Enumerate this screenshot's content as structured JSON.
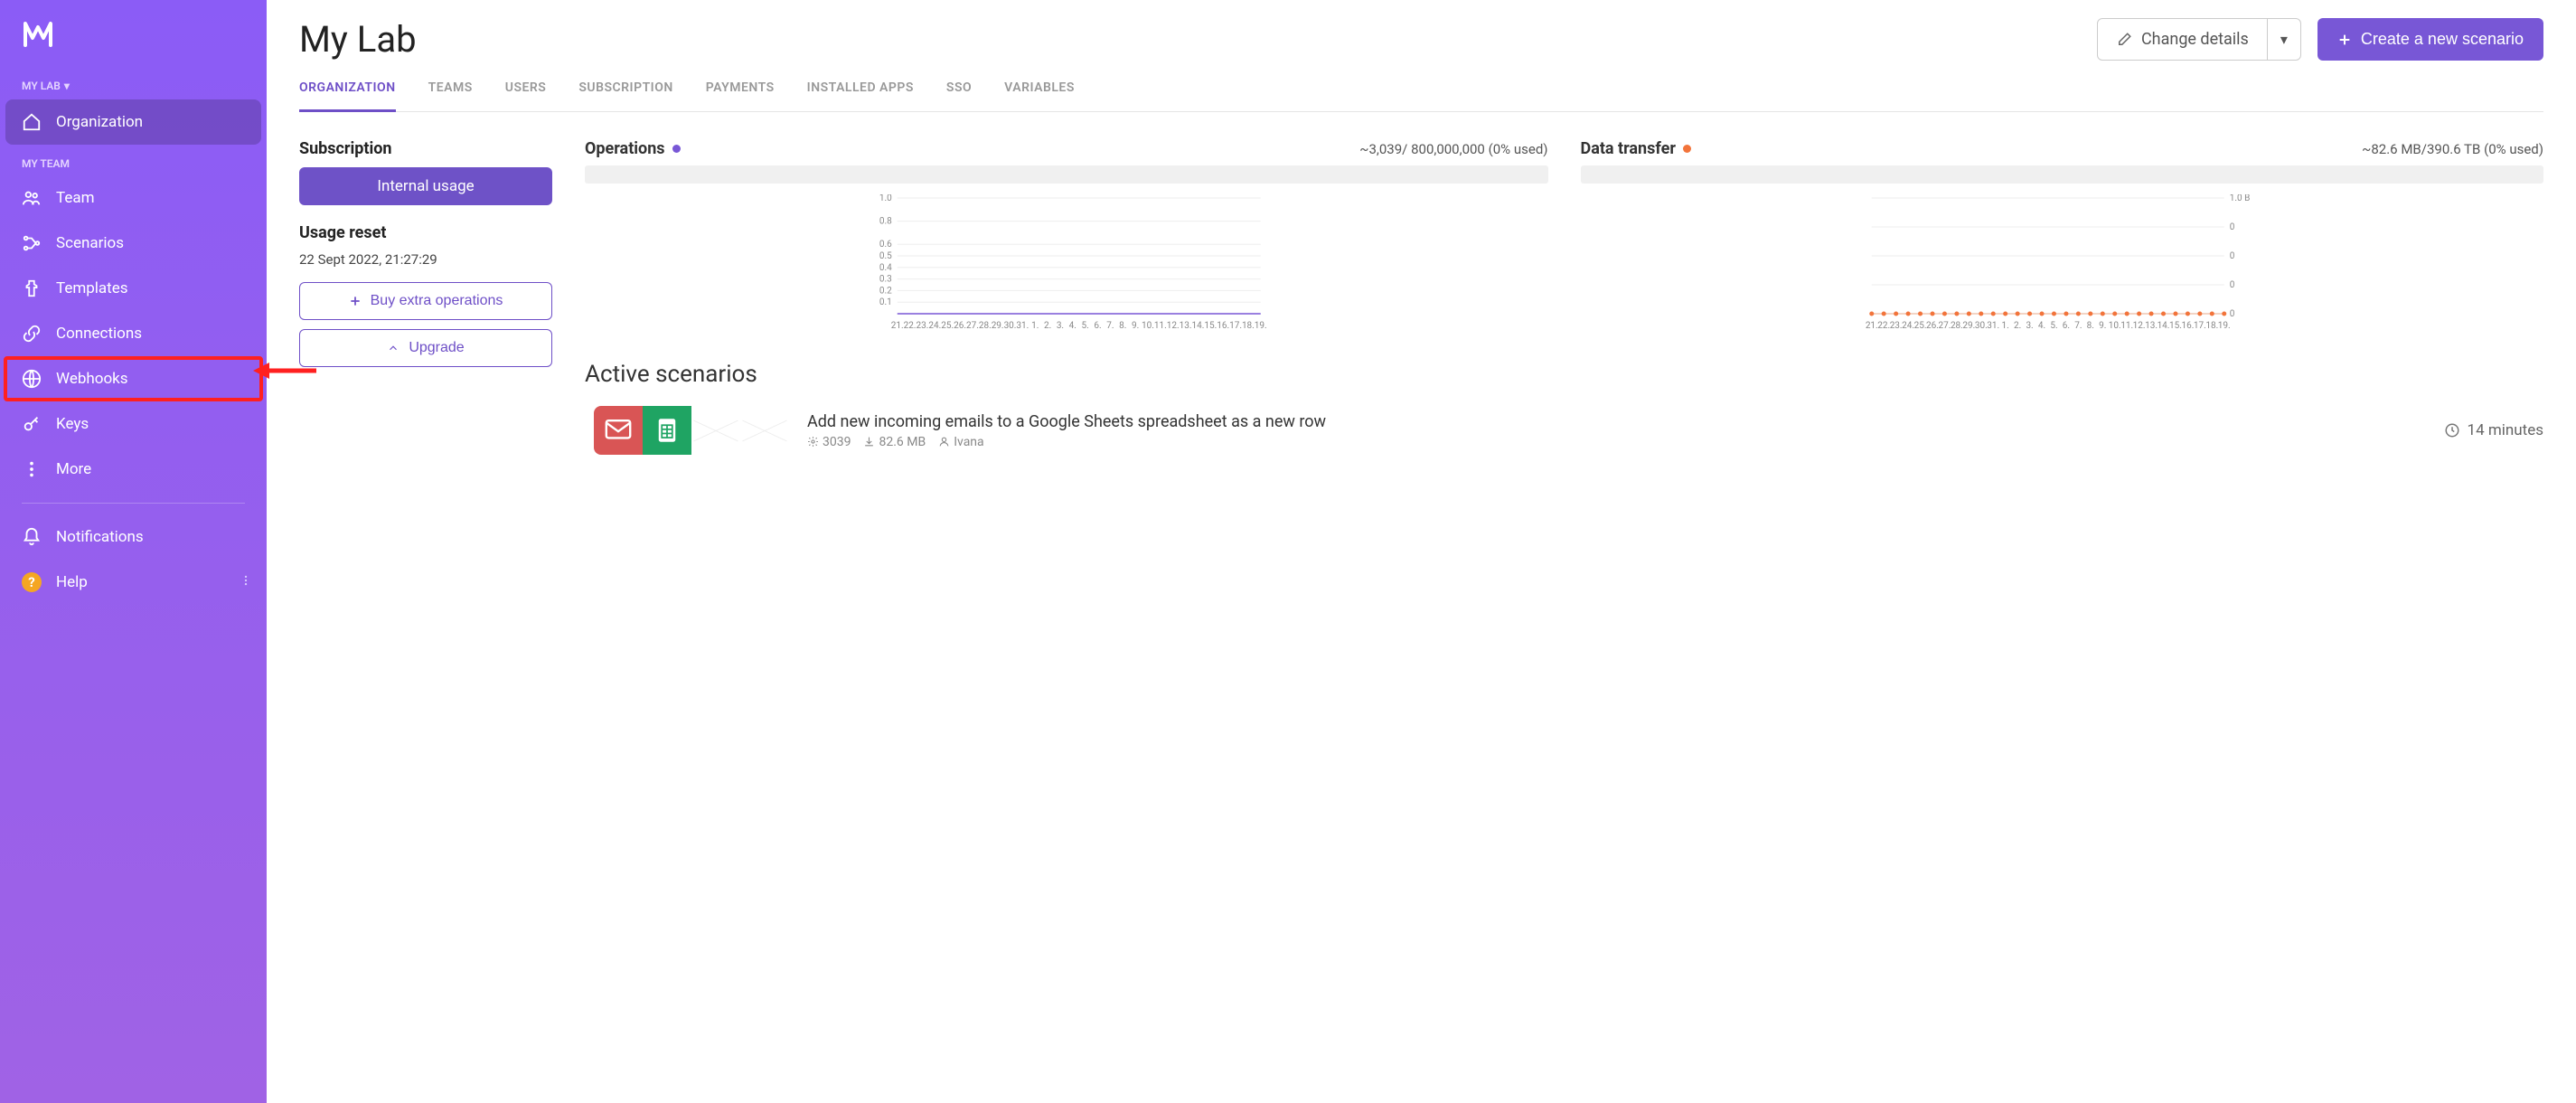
{
  "sidebar": {
    "org_selector": "MY LAB",
    "section_my_team": "MY TEAM",
    "items": {
      "organization": "Organization",
      "team": "Team",
      "scenarios": "Scenarios",
      "templates": "Templates",
      "connections": "Connections",
      "webhooks": "Webhooks",
      "keys": "Keys",
      "more": "More",
      "notifications": "Notifications",
      "help": "Help"
    }
  },
  "header": {
    "title": "My Lab",
    "change_details": "Change details",
    "create_scenario": "Create a new scenario"
  },
  "tabs": {
    "organization": "ORGANIZATION",
    "teams": "TEAMS",
    "users": "USERS",
    "subscription": "SUBSCRIPTION",
    "payments": "PAYMENTS",
    "installed_apps": "INSTALLED APPS",
    "sso": "SSO",
    "variables": "VARIABLES"
  },
  "subscription": {
    "heading": "Subscription",
    "badge": "Internal usage",
    "usage_reset": "Usage reset",
    "usage_reset_date": "22 Sept 2022, 21:27:29",
    "buy_extra": "Buy extra operations",
    "upgrade": "Upgrade"
  },
  "operations": {
    "title": "Operations",
    "stat": "~3,039/ 800,000,000 (0% used)"
  },
  "data_transfer": {
    "title": "Data transfer",
    "stat": "~82.6 MB/390.6 TB (0% used)"
  },
  "active_scenarios": {
    "title": "Active scenarios",
    "item": {
      "name": "Add new incoming emails to a Google Sheets spreadsheet as a new row",
      "ops": "3039",
      "data": "82.6 MB",
      "user": "Ivana",
      "time": "14 minutes"
    }
  },
  "chart_data": [
    {
      "type": "line",
      "title": "Operations",
      "ylabel": "",
      "ylim": [
        0,
        1.0
      ],
      "y_ticks": [
        0.1,
        0.2,
        0.3,
        0.4,
        0.5,
        0.6,
        0.8,
        1.0
      ],
      "categories": [
        "21.",
        "22.",
        "23.",
        "24.",
        "25.",
        "26.",
        "27.",
        "28.",
        "29.",
        "30.",
        "31.",
        "1.",
        "2.",
        "3.",
        "4.",
        "5.",
        "6.",
        "7.",
        "8.",
        "9.",
        "10.",
        "11.",
        "12.",
        "13.",
        "14.",
        "15.",
        "16.",
        "17.",
        "18.",
        "19."
      ],
      "values": [
        0,
        0,
        0,
        0,
        0,
        0,
        0,
        0,
        0,
        0,
        0,
        0,
        0,
        0,
        0,
        0,
        0,
        0,
        0,
        0,
        0,
        0,
        0,
        0,
        0,
        0,
        0,
        0,
        0,
        0
      ]
    },
    {
      "type": "line",
      "title": "Data transfer",
      "ylabel": "",
      "ylim": [
        0,
        1.0
      ],
      "y_ticks_labels": [
        "0",
        "0",
        "0",
        "0",
        "1.0 B"
      ],
      "categories": [
        "21.",
        "22.",
        "23.",
        "24.",
        "25.",
        "26.",
        "27.",
        "28.",
        "29.",
        "30.",
        "31.",
        "1.",
        "2.",
        "3.",
        "4.",
        "5.",
        "6.",
        "7.",
        "8.",
        "9.",
        "10.",
        "11.",
        "12.",
        "13.",
        "14.",
        "15.",
        "16.",
        "17.",
        "18.",
        "19."
      ],
      "values": [
        0,
        0,
        0,
        0,
        0,
        0,
        0,
        0,
        0,
        0,
        0,
        0,
        0,
        0,
        0,
        0,
        0,
        0,
        0,
        0,
        0,
        0,
        0,
        0,
        0,
        0,
        0,
        0,
        0,
        0
      ]
    }
  ]
}
